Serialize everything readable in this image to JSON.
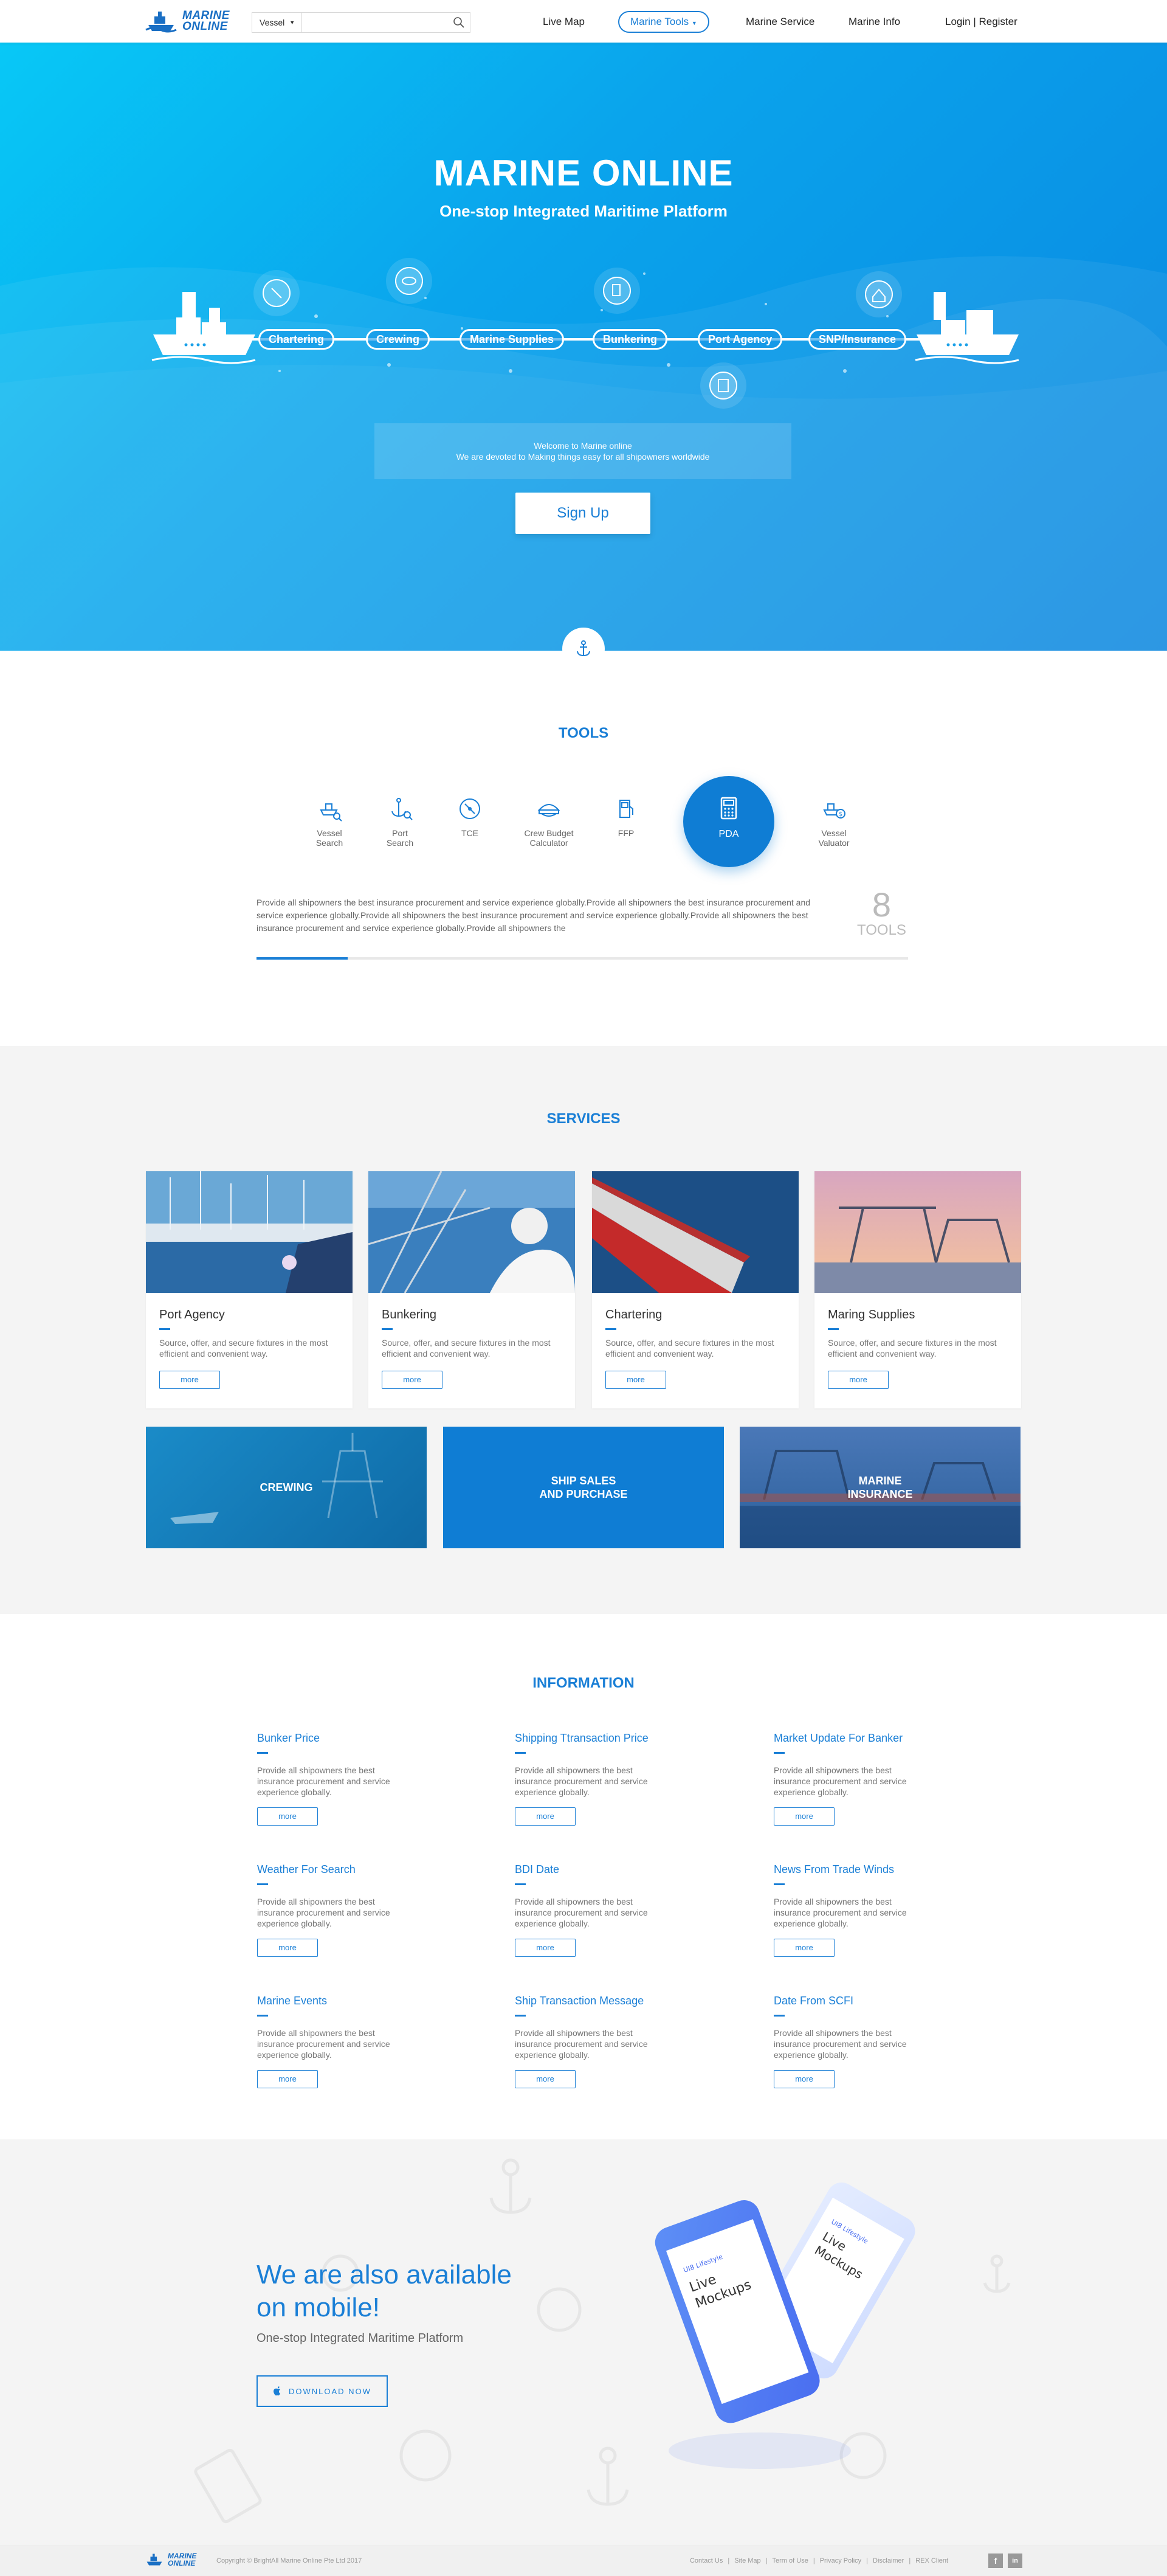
{
  "header": {
    "logo_text_1": "MARINE",
    "logo_text_2": "ONLINE",
    "search_select": "Vessel",
    "search_placeholder": "",
    "nav": {
      "live_map": "Live Map",
      "marine_tools": "Marine Tools",
      "marine_service": "Marine Service",
      "marine_info": "Marine Info",
      "login": "Login | Register"
    }
  },
  "hero": {
    "title": "MARINE ONLINE",
    "subtitle": "One-stop Integrated Maritime Platform",
    "route": [
      "Chartering",
      "Crewing",
      "Marine Supplies",
      "Bunkering",
      "Port Agency",
      "SNP/Insurance"
    ],
    "welcome_line1": "Welcome to Marine online",
    "welcome_line2": "We are devoted to Making things easy for all shipowners worldwide",
    "signup": "Sign Up"
  },
  "tools": {
    "title": "TOOLS",
    "items": [
      {
        "l1": "Vessel",
        "l2": "Search"
      },
      {
        "l1": "Port",
        "l2": "Search"
      },
      {
        "l1": "TCE",
        "l2": ""
      },
      {
        "l1": "Crew Budget",
        "l2": "Calculator"
      },
      {
        "l1": "FFP",
        "l2": ""
      },
      {
        "l1": "PDA",
        "l2": ""
      },
      {
        "l1": "Vessel",
        "l2": "Valuator"
      }
    ],
    "description": "Provide all shipowners the best insurance procurement and service experience globally.Provide all shipowners the best insurance procurement and service experience globally.Provide all shipowners the best insurance procurement and service experience globally.Provide all shipowners the best insurance procurement and service experience globally.Provide all shipowners the",
    "count": "8",
    "count_label": "TOOLS",
    "progress_fraction": 0.14
  },
  "services": {
    "title": "SERVICES",
    "cards": [
      {
        "title": "Port Agency",
        "desc": "Source, offer, and secure fixtures in the most efficient and convenient way.",
        "more": "more"
      },
      {
        "title": "Bunkering",
        "desc": "Source, offer, and secure fixtures in the most efficient and convenient way.",
        "more": "more"
      },
      {
        "title": "Chartering",
        "desc": "Source, offer, and secure fixtures in the most efficient and convenient way.",
        "more": "more"
      },
      {
        "title": "Maring Supplies",
        "desc": "Source, offer, and secure fixtures in the most efficient and convenient way.",
        "more": "more"
      }
    ],
    "banners": [
      {
        "l1": "CREWING",
        "l2": ""
      },
      {
        "l1": "SHIP SALES",
        "l2": "AND PURCHASE"
      },
      {
        "l1": "MARINE",
        "l2": "INSURANCE"
      }
    ]
  },
  "information": {
    "title": "INFORMATION",
    "items": [
      {
        "title": "Bunker Price",
        "desc": "Provide all shipowners the best insurance procurement and service experience globally.",
        "more": "more"
      },
      {
        "title": "Shipping Ttransaction Price",
        "desc": "Provide all shipowners the best insurance procurement and service experience globally.",
        "more": "more"
      },
      {
        "title": "Market Update For Banker",
        "desc": "Provide all shipowners the best insurance procurement and service experience globally.",
        "more": "more"
      },
      {
        "title": "Weather For Search",
        "desc": "Provide all shipowners the best insurance procurement and service experience globally.",
        "more": "more"
      },
      {
        "title": "BDI Date",
        "desc": "Provide all shipowners the best insurance procurement and service experience globally.",
        "more": "more"
      },
      {
        "title": "News From Trade Winds",
        "desc": "Provide all shipowners the best insurance procurement and service experience globally.",
        "more": "more"
      },
      {
        "title": "Marine Events",
        "desc": "Provide all shipowners the best insurance procurement and service experience globally.",
        "more": "more"
      },
      {
        "title": "Ship Transaction Message",
        "desc": "Provide all shipowners the best insurance procurement and service experience globally.",
        "more": "more"
      },
      {
        "title": "Date From SCFI",
        "desc": "Provide all shipowners the best insurance procurement and service experience globally.",
        "more": "more"
      }
    ]
  },
  "mobile": {
    "title_l1": "We are also available",
    "title_l2": "on mobile!",
    "subtitle": "One-stop Integrated Maritime Platform",
    "download": "DOWNLOAD NOW",
    "phone_text_1": "Live",
    "phone_text_2": "Mockups",
    "phone_tag": "UI8 Lifestyle"
  },
  "footer": {
    "logo_text_1": "MARINE",
    "logo_text_2": "ONLINE",
    "copyright": "Copyright © BrightAll Marine Online Pte Ltd 2017",
    "links": [
      "Contact Us",
      "|",
      "Site Map",
      "|",
      "Term of Use",
      "|",
      "Privacy Policy",
      "|",
      "Disclaimer",
      "|",
      "REX  Client"
    ],
    "social": [
      "f",
      "in"
    ]
  },
  "colors": {
    "brand": "#1a7fd6",
    "hero_start": "#08c8f6",
    "hero_end": "#0a86e0",
    "section_bg": "#f4f4f4"
  }
}
